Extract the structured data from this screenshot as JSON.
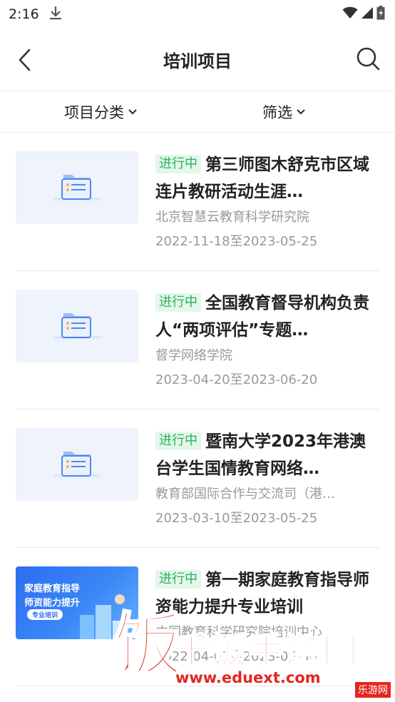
{
  "status_bar": {
    "time": "2:16"
  },
  "header": {
    "title": "培训项目"
  },
  "filters": [
    {
      "label": "项目分类"
    },
    {
      "label": "筛选"
    }
  ],
  "items": [
    {
      "badge": "进行中",
      "title": "第三师图木舒克市区域连片教研活动生涯…",
      "org": "北京智慧云教育科学研究院",
      "date": "2022-11-18至2023-05-25"
    },
    {
      "badge": "进行中",
      "title": "全国教育督导机构负责人“两项评估”专题…",
      "org": "督学网络学院",
      "date": "2023-04-20至2023-06-20"
    },
    {
      "badge": "进行中",
      "title": "暨南大学2023年港澳台学生国情教育网络…",
      "org": "教育部国际合作与交流司（港…",
      "date": "2023-03-10至2023-05-25"
    },
    {
      "badge": "进行中",
      "title": "第一期家庭教育指导师资能力提升专业培训",
      "org": "中国教育科学研究院培训中心",
      "date": "2022-04-01至2023-06-30"
    }
  ],
  "promo_thumb": {
    "line1": "家庭教育指导",
    "line2": "师资能力提升",
    "tag": "专业培训"
  },
  "watermark": {
    "char": "饭",
    "title": "千饭手游网",
    "url": "www.eduext.com",
    "corner": "乐游网"
  },
  "colors": {
    "badge_text": "#2bb35a",
    "badge_bg": "#e3f7ea",
    "watermark": "#e4271e"
  }
}
